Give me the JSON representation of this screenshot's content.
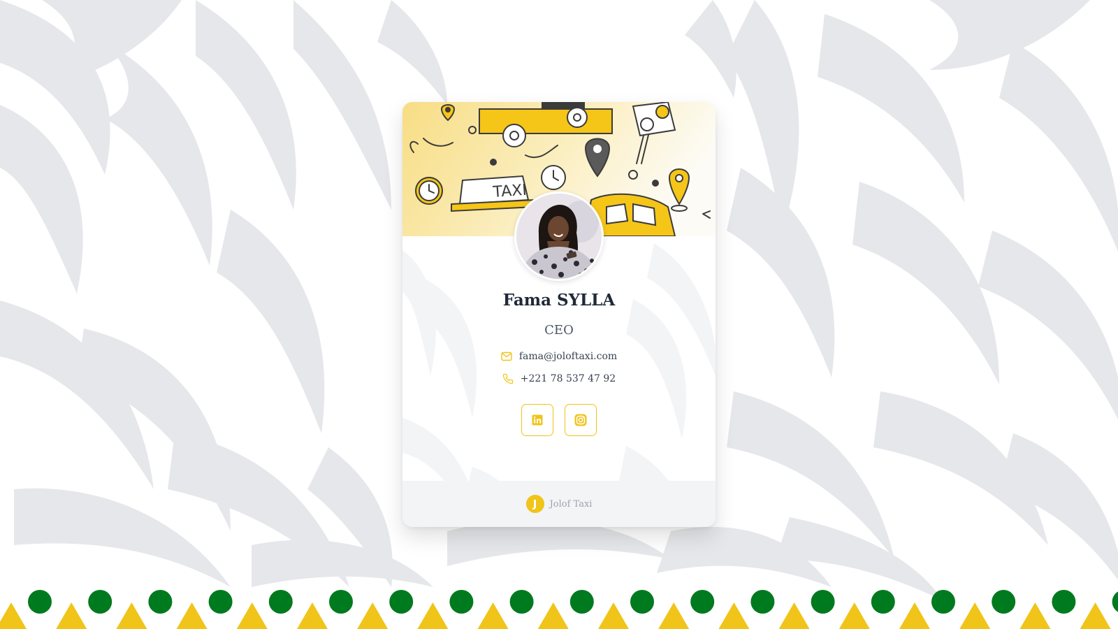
{
  "colors": {
    "accent": "#f0c419",
    "green": "#007a1e",
    "pattern_gray": "#e6e7ea",
    "text_dark": "#1f2937",
    "footer_bg": "#f3f4f6"
  },
  "card": {
    "cover_image": "taxi-doodle-illustration",
    "avatar": "profile-photo",
    "name": "Fama SYLLA",
    "role": "CEO",
    "email": {
      "icon": "mail-icon",
      "text": "fama@joloftaxi.com"
    },
    "phone": {
      "icon": "phone-icon",
      "text": "+221 78 537 47 92"
    },
    "socials": [
      {
        "icon": "linkedin-icon"
      },
      {
        "icon": "instagram-icon"
      }
    ],
    "footer": {
      "badge_letter": "J",
      "company": "Jolof Taxi"
    }
  }
}
